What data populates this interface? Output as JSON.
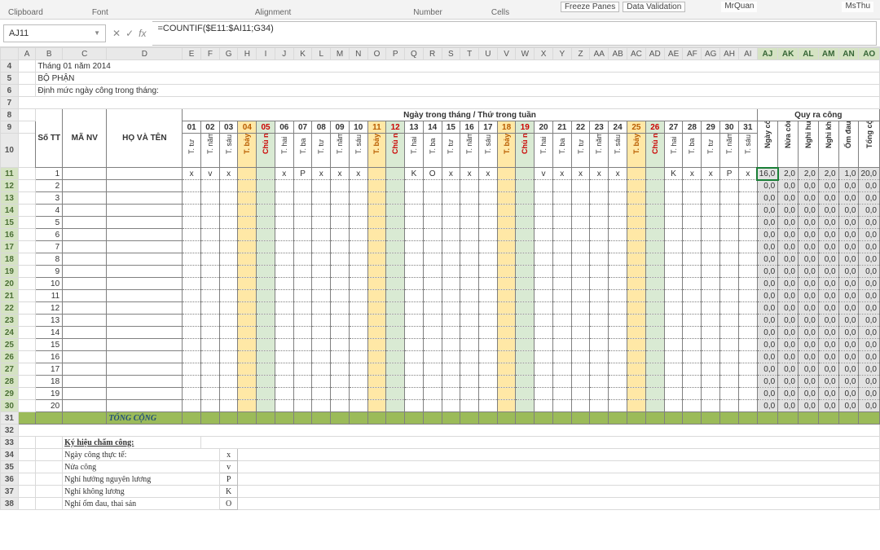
{
  "ribbon": {
    "groups": [
      "Clipboard",
      "Font",
      "Alignment",
      "Number",
      "Cells"
    ],
    "buttons": [
      "Freeze Panes",
      "Data Validation"
    ],
    "custom": [
      "MrQuan",
      "MsThu"
    ]
  },
  "formula_bar": {
    "cell_ref": "AJ11",
    "formula": "=COUNTIF($E11:$AI11;G34)"
  },
  "columns": [
    "A",
    "B",
    "C",
    "D",
    "E",
    "F",
    "G",
    "H",
    "I",
    "J",
    "K",
    "L",
    "M",
    "N",
    "O",
    "P",
    "Q",
    "R",
    "S",
    "T",
    "U",
    "V",
    "W",
    "X",
    "Y",
    "Z",
    "AA",
    "AB",
    "AC",
    "AD",
    "AE",
    "AF",
    "AG",
    "AH",
    "AI",
    "AJ",
    "AK",
    "AL",
    "AM",
    "AN",
    "AO"
  ],
  "sel_cols": [
    "AJ",
    "AK",
    "AL",
    "AM",
    "AN",
    "AO"
  ],
  "top": {
    "r4": "Tháng 01 năm 2014",
    "r5": "BỘ PHẬN",
    "r6": "Định mức ngày công trong tháng:"
  },
  "headers": {
    "stt": "Số TT",
    "manv": "MÃ NV",
    "hoten": "HỌ VÀ TÊN",
    "days_title": "Ngày trong tháng / Thứ trong tuần",
    "sum_title": "Quy ra công",
    "sum_cols": [
      "Ngày công thực tế",
      "Nửa công",
      "Nghỉ hưởng lương",
      "Nghỉ không lương",
      "Ốm đau, thai sản",
      "Tổng cộng"
    ]
  },
  "days": [
    {
      "n": "01",
      "dow": "T. tư",
      "t": ""
    },
    {
      "n": "02",
      "dow": "T. năm",
      "t": ""
    },
    {
      "n": "03",
      "dow": "T. sáu",
      "t": ""
    },
    {
      "n": "04",
      "dow": "T. bảy",
      "t": "sat"
    },
    {
      "n": "05",
      "dow": "Chủ nhật",
      "t": "sun"
    },
    {
      "n": "06",
      "dow": "T. hai",
      "t": ""
    },
    {
      "n": "07",
      "dow": "T. ba",
      "t": ""
    },
    {
      "n": "08",
      "dow": "T. tư",
      "t": ""
    },
    {
      "n": "09",
      "dow": "T. năm",
      "t": ""
    },
    {
      "n": "10",
      "dow": "T. sáu",
      "t": ""
    },
    {
      "n": "11",
      "dow": "T. bảy",
      "t": "sat"
    },
    {
      "n": "12",
      "dow": "Chủ nhật",
      "t": "sun"
    },
    {
      "n": "13",
      "dow": "T. hai",
      "t": ""
    },
    {
      "n": "14",
      "dow": "T. ba",
      "t": ""
    },
    {
      "n": "15",
      "dow": "T. tư",
      "t": ""
    },
    {
      "n": "16",
      "dow": "T. năm",
      "t": ""
    },
    {
      "n": "17",
      "dow": "T. sáu",
      "t": ""
    },
    {
      "n": "18",
      "dow": "T. bảy",
      "t": "sat"
    },
    {
      "n": "19",
      "dow": "Chủ nhật",
      "t": "sun"
    },
    {
      "n": "20",
      "dow": "T. hai",
      "t": ""
    },
    {
      "n": "21",
      "dow": "T. ba",
      "t": ""
    },
    {
      "n": "22",
      "dow": "T. tư",
      "t": ""
    },
    {
      "n": "23",
      "dow": "T. năm",
      "t": ""
    },
    {
      "n": "24",
      "dow": "T. sáu",
      "t": ""
    },
    {
      "n": "25",
      "dow": "T. bảy",
      "t": "sat"
    },
    {
      "n": "26",
      "dow": "Chủ nhật",
      "t": "sun"
    },
    {
      "n": "27",
      "dow": "T. hai",
      "t": ""
    },
    {
      "n": "28",
      "dow": "T. ba",
      "t": ""
    },
    {
      "n": "29",
      "dow": "T. tư",
      "t": ""
    },
    {
      "n": "30",
      "dow": "T. năm",
      "t": ""
    },
    {
      "n": "31",
      "dow": "T. sáu",
      "t": ""
    }
  ],
  "row11_data": [
    "x",
    "v",
    "x",
    "",
    "",
    "x",
    "P",
    "x",
    "x",
    "x",
    "",
    "",
    "K",
    "O",
    "x",
    "x",
    "x",
    "",
    "",
    "v",
    "x",
    "x",
    "x",
    "x",
    "",
    "",
    "K",
    "x",
    "x",
    "P",
    "x"
  ],
  "row11_sum": [
    "16,0",
    "2,0",
    "2,0",
    "2,0",
    "1,0",
    "20,0"
  ],
  "empty_sum": [
    "0,0",
    "0,0",
    "0,0",
    "0,0",
    "0,0",
    "0,0"
  ],
  "rows_visible": 20,
  "total_label": "TỔNG CỘNG",
  "legend": {
    "title": "Ký hiệu chấm công:",
    "items": [
      {
        "label": "Ngày công thực tế:",
        "sym": "x"
      },
      {
        "label": "Nửa công",
        "sym": "v"
      },
      {
        "label": "Nghỉ hưởng nguyên lương",
        "sym": "P"
      },
      {
        "label": "Nghỉ không lương",
        "sym": "K"
      },
      {
        "label": "Nghỉ ốm đau, thai sản",
        "sym": "O"
      }
    ]
  }
}
